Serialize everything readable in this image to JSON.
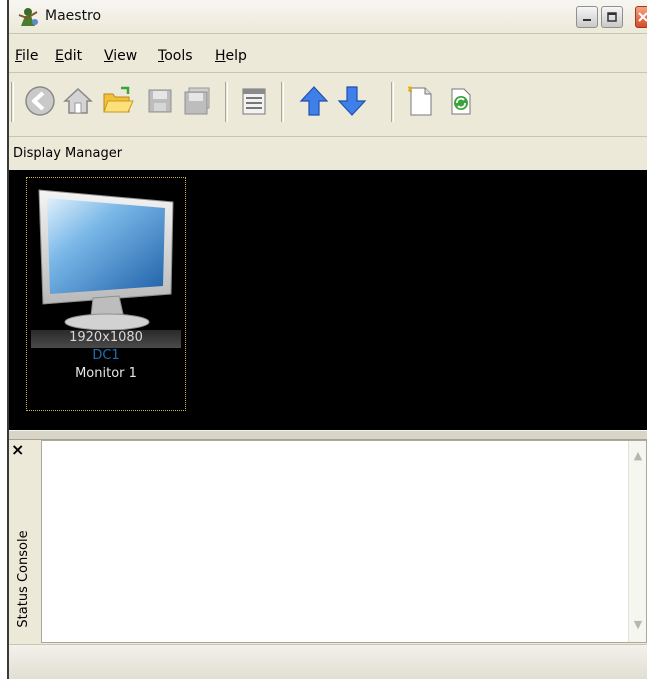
{
  "window": {
    "title": "Maestro",
    "app_icon": "maestro-app-icon",
    "controls": [
      "minimize-icon",
      "maximize-icon",
      "close-icon"
    ]
  },
  "menu": {
    "items": [
      {
        "label_first": "F",
        "label_rest": "ile"
      },
      {
        "label_first": "E",
        "label_rest": "dit"
      },
      {
        "label_first": "V",
        "label_rest": "iew"
      },
      {
        "label_first": "T",
        "label_rest": "ools"
      },
      {
        "label_first": "H",
        "label_rest": "elp"
      }
    ]
  },
  "toolbar": {
    "buttons": [
      "back-icon",
      "home-icon",
      "open-folder-icon",
      "save-icon",
      "save-all-icon",
      "properties-icon",
      "move-up-icon",
      "move-down-icon",
      "new-document-icon",
      "refresh-icon"
    ]
  },
  "display_manager": {
    "label": "Display Manager",
    "monitor": {
      "resolution": "1920x1080",
      "id": "DC1",
      "name": "Monitor 1"
    }
  },
  "console": {
    "title": "Status Console",
    "close_symbol": "×"
  },
  "colors": {
    "window_bg": "#ece9d8",
    "display_bg": "#000000",
    "monitor_id_color": "#1f6fb0",
    "up_arrow": "#2f6fe0",
    "refresh": "#3aa33a"
  }
}
